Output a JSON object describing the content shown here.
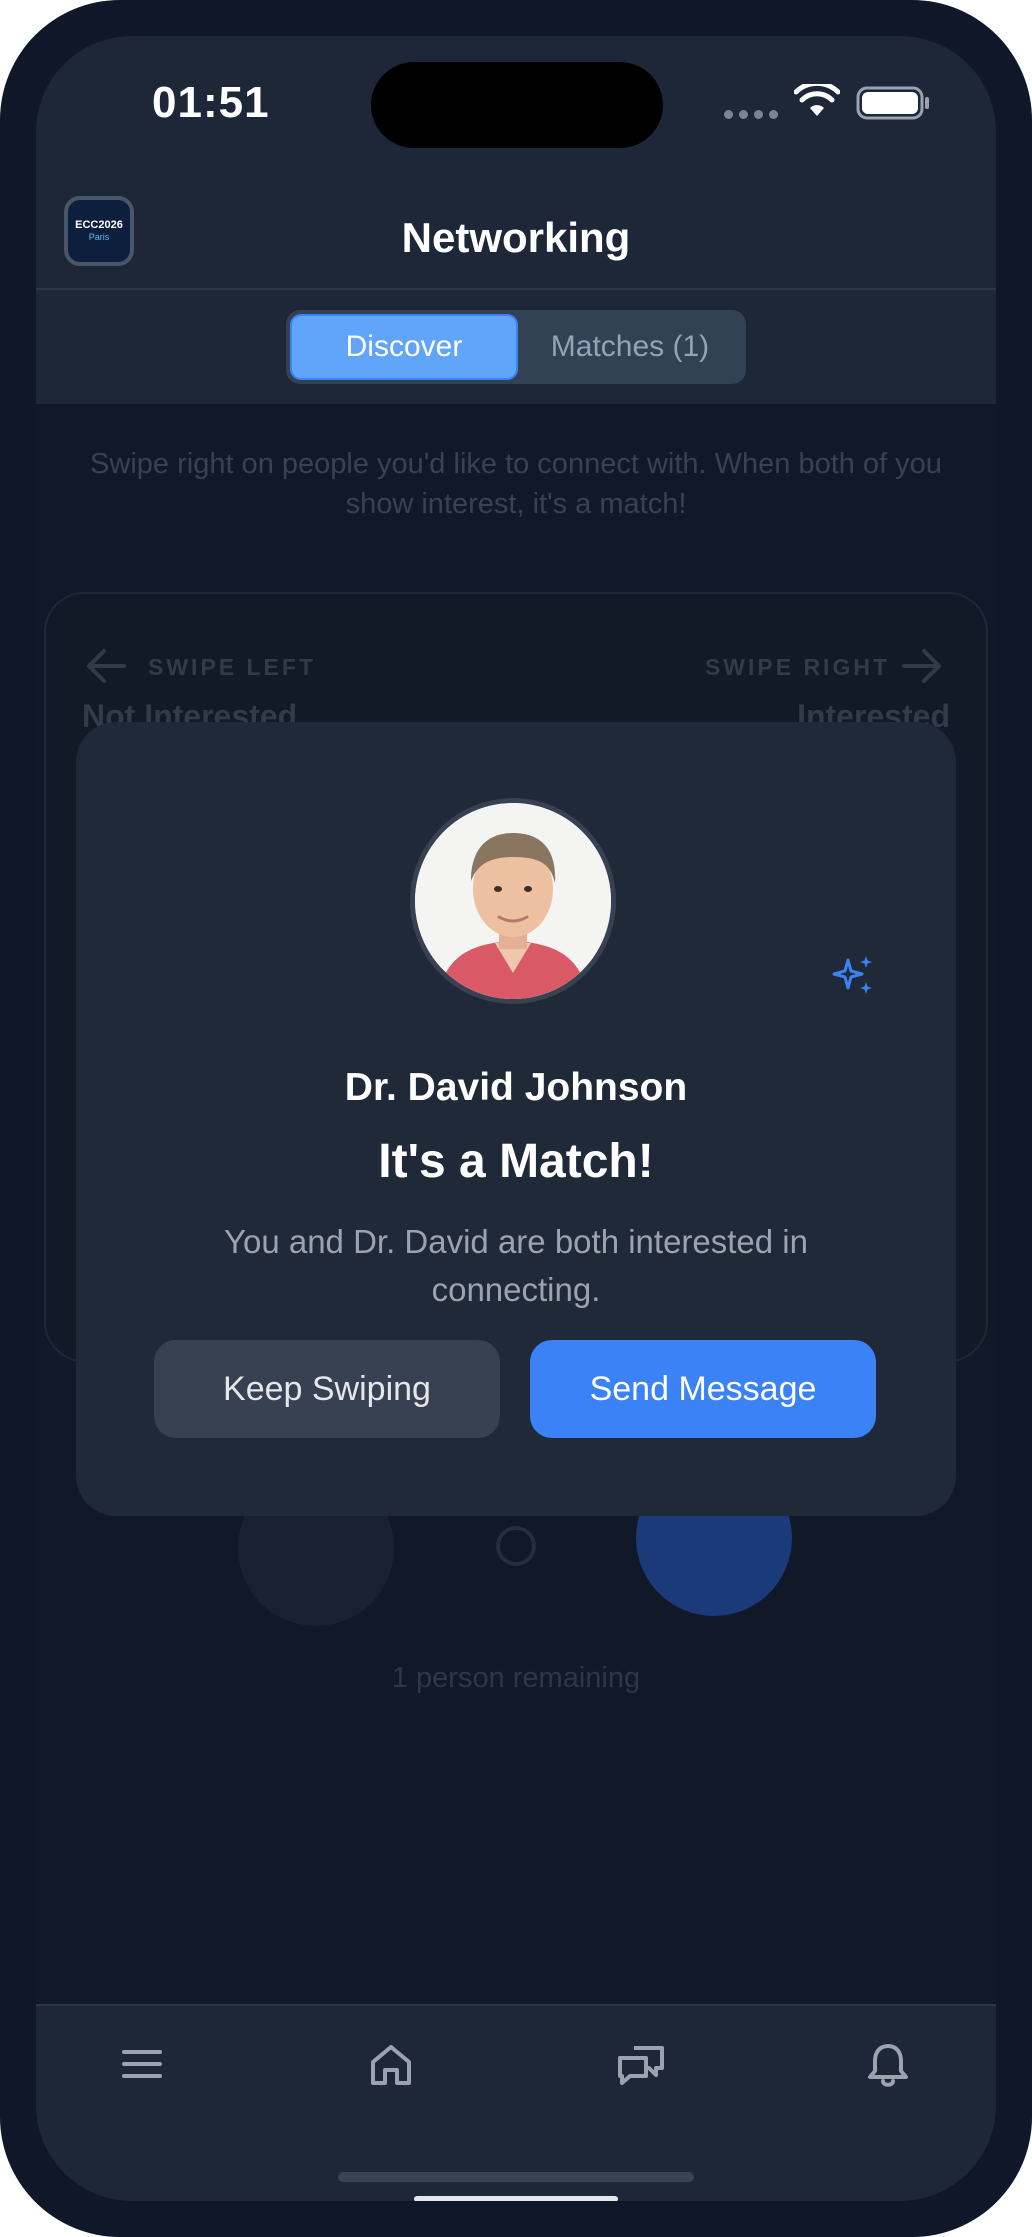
{
  "status_bar": {
    "time": "01:51"
  },
  "header": {
    "title": "Networking",
    "logo_line1": "ECC2026",
    "logo_line2": "Paris"
  },
  "tabs": [
    {
      "label": "Discover",
      "active": true
    },
    {
      "label": "Matches (1)",
      "active": false
    }
  ],
  "discover": {
    "intro": "Swipe right on people you'd like to connect with. When both of you show interest, it's a match!",
    "swipe_left_label": "SWIPE LEFT",
    "swipe_left_meaning": "Not Interested",
    "swipe_right_label": "SWIPE RIGHT",
    "swipe_right_meaning": "Interested",
    "remaining": "1 person remaining"
  },
  "match_modal": {
    "name": "Dr. David Johnson",
    "heading": "It's a Match!",
    "description": "You and Dr. David are both interested in connecting.",
    "keep_swiping_label": "Keep Swiping",
    "send_message_label": "Send Message",
    "accent_color": "#3b82f6"
  },
  "tab_bar": {
    "items": [
      "menu-icon",
      "home-icon",
      "chat-icon",
      "bell-icon"
    ]
  }
}
